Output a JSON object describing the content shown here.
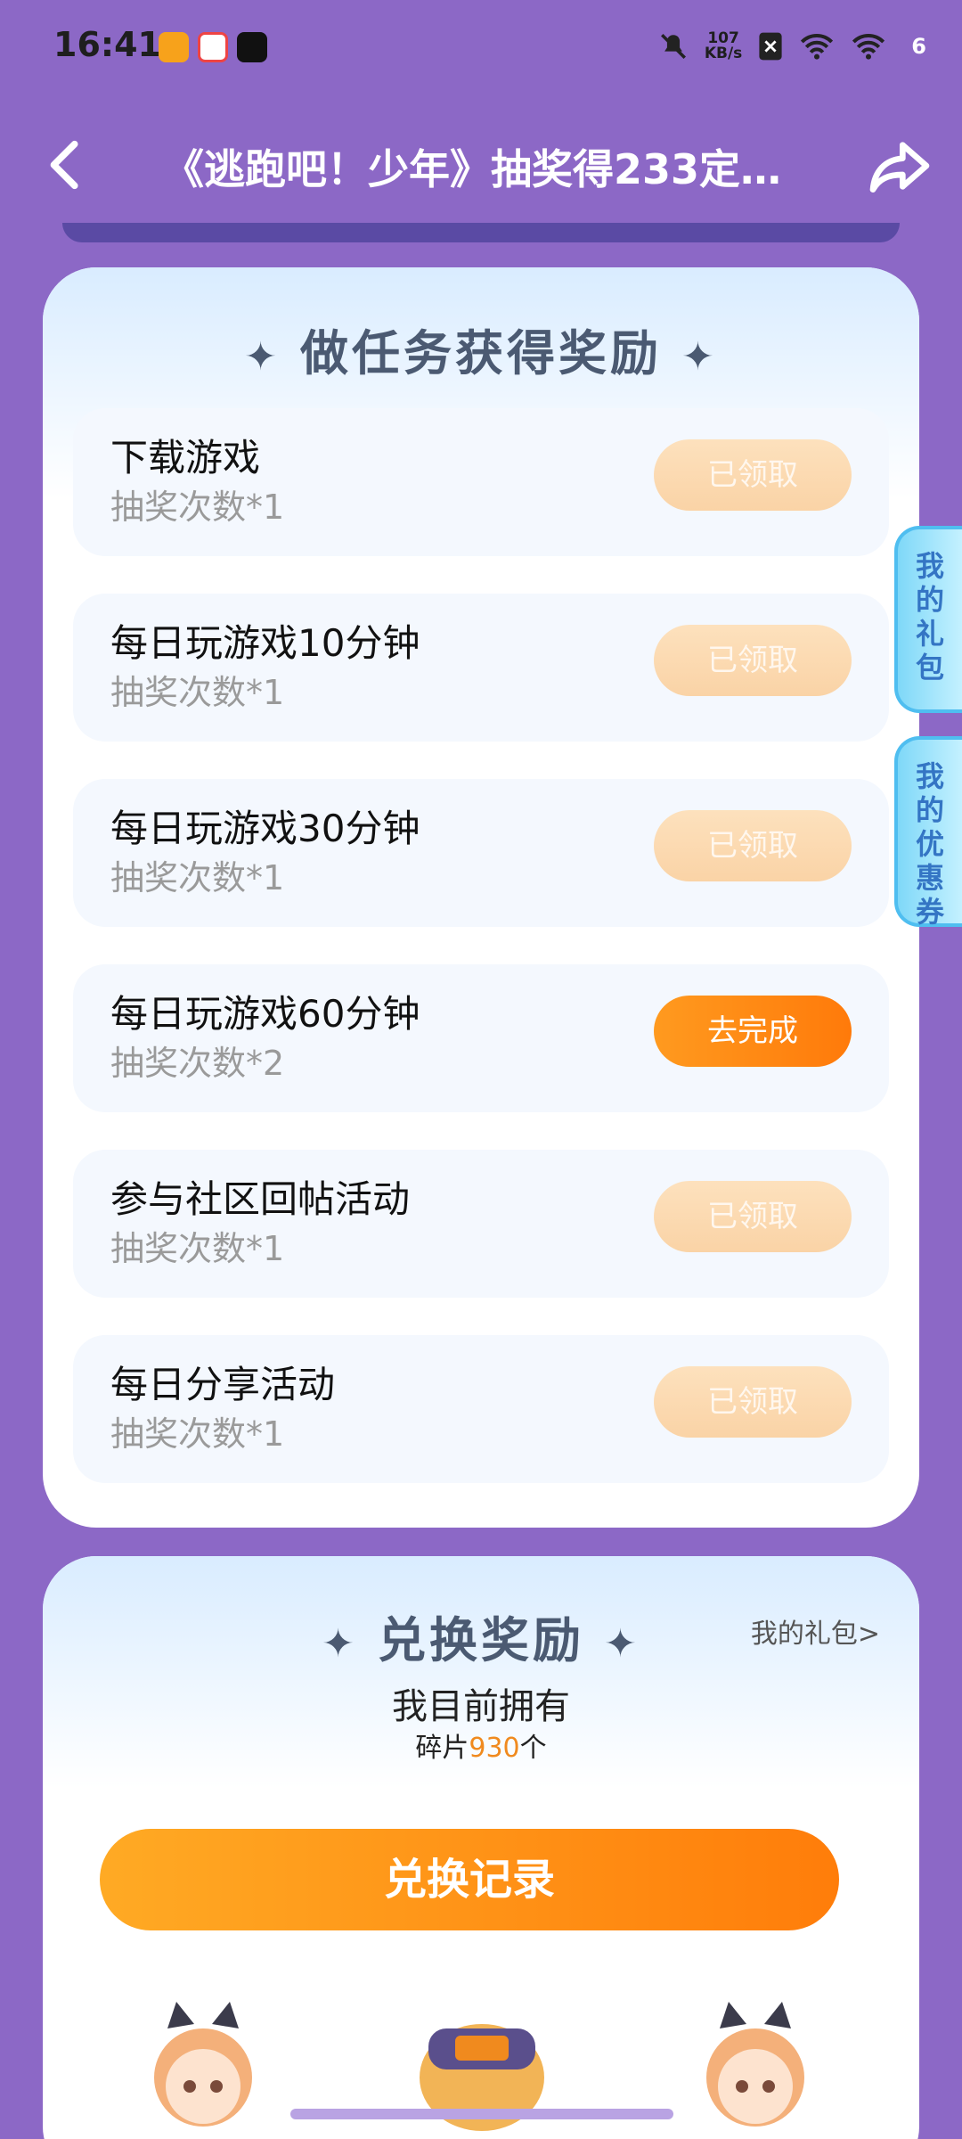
{
  "status_bar": {
    "time": "16:41",
    "net_speed_value": "107",
    "net_speed_unit": "KB/s",
    "battery": "6"
  },
  "header": {
    "title": "《逃跑吧！少年》抽奖得233定…"
  },
  "tasks_section": {
    "title": "做任务获得奖励",
    "items": [
      {
        "name": "下载游戏",
        "reward": "抽奖次数*1",
        "button": "已领取",
        "state": "done"
      },
      {
        "name": "每日玩游戏10分钟",
        "reward": "抽奖次数*1",
        "button": "已领取",
        "state": "done"
      },
      {
        "name": "每日玩游戏30分钟",
        "reward": "抽奖次数*1",
        "button": "已领取",
        "state": "done"
      },
      {
        "name": "每日玩游戏60分钟",
        "reward": "抽奖次数*2",
        "button": "去完成",
        "state": "todo"
      },
      {
        "name": "参与社区回帖活动",
        "reward": "抽奖次数*1",
        "button": "已领取",
        "state": "done"
      },
      {
        "name": "每日分享活动",
        "reward": "抽奖次数*1",
        "button": "已领取",
        "state": "done"
      }
    ]
  },
  "side_tabs": {
    "gift": "我的礼包",
    "coupon": "我的优惠券"
  },
  "exchange_section": {
    "title": "兑换奖励",
    "my_gift_link": "我的礼包>",
    "own_label": "我目前拥有",
    "fragment_prefix": "碎片",
    "fragment_count": "930",
    "fragment_suffix": "个",
    "record_button": "兑换记录"
  },
  "colors": {
    "background": "#8c68c6",
    "accent_orange": "#ff8a14",
    "done_button": "#fbd9b0"
  }
}
